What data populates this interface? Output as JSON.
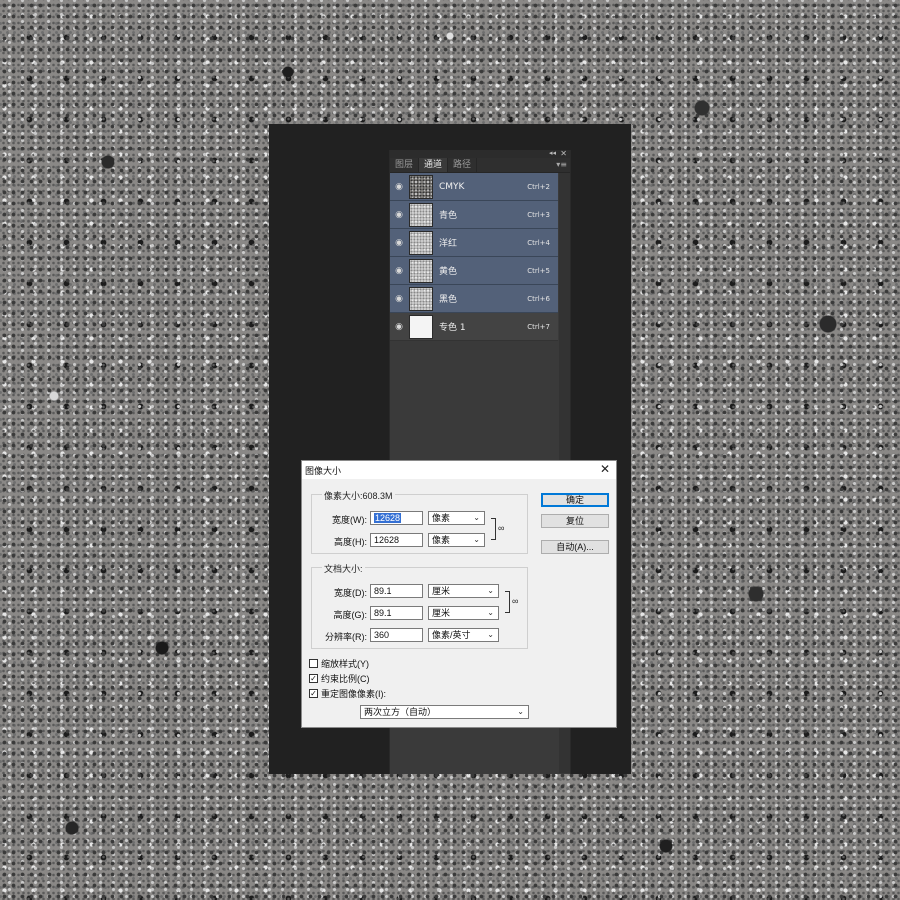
{
  "panel": {
    "tabs": [
      {
        "label": "图层"
      },
      {
        "label": "通道"
      },
      {
        "label": "路径"
      }
    ],
    "active_tab": "通道",
    "channels": [
      {
        "name": "CMYK",
        "shortcut": "Ctrl+2"
      },
      {
        "name": "青色",
        "shortcut": "Ctrl+3"
      },
      {
        "name": "洋红",
        "shortcut": "Ctrl+4"
      },
      {
        "name": "黄色",
        "shortcut": "Ctrl+5"
      },
      {
        "name": "黑色",
        "shortcut": "Ctrl+6"
      },
      {
        "name": "专色 1",
        "shortcut": "Ctrl+7"
      }
    ]
  },
  "dialog": {
    "title": "图像大小",
    "pixel_dimensions": {
      "legend": "像素大小:608.3M",
      "width_label": "宽度(W):",
      "width_value": "12628",
      "width_unit": "像素",
      "height_label": "高度(H):",
      "height_value": "12628",
      "height_unit": "像素"
    },
    "document_size": {
      "legend": "文档大小:",
      "width_label": "宽度(D):",
      "width_value": "89.1",
      "width_unit": "厘米",
      "height_label": "高度(G):",
      "height_value": "89.1",
      "height_unit": "厘米",
      "resolution_label": "分辨率(R):",
      "resolution_value": "360",
      "resolution_unit": "像素/英寸"
    },
    "buttons": {
      "ok": "确定",
      "reset": "复位",
      "auto": "自动(A)..."
    },
    "options": {
      "scale_styles": {
        "label": "缩放样式(Y)",
        "checked": false
      },
      "constrain": {
        "label": "约束比例(C)",
        "checked": true
      },
      "resample": {
        "label": "重定图像像素(I):",
        "checked": true
      }
    },
    "resample_method": "两次立方（自动）"
  }
}
